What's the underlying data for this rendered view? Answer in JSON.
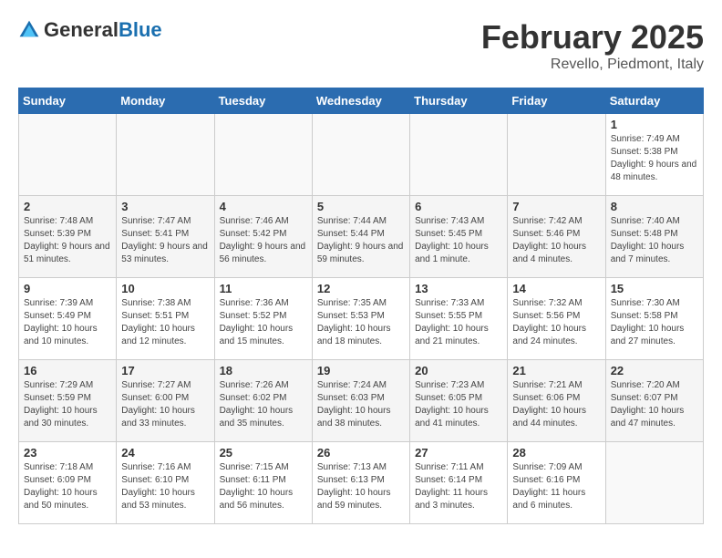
{
  "header": {
    "logo_general": "General",
    "logo_blue": "Blue",
    "title": "February 2025",
    "subtitle": "Revello, Piedmont, Italy"
  },
  "calendar": {
    "days_of_week": [
      "Sunday",
      "Monday",
      "Tuesday",
      "Wednesday",
      "Thursday",
      "Friday",
      "Saturday"
    ],
    "weeks": [
      [
        {
          "day": "",
          "info": ""
        },
        {
          "day": "",
          "info": ""
        },
        {
          "day": "",
          "info": ""
        },
        {
          "day": "",
          "info": ""
        },
        {
          "day": "",
          "info": ""
        },
        {
          "day": "",
          "info": ""
        },
        {
          "day": "1",
          "info": "Sunrise: 7:49 AM\nSunset: 5:38 PM\nDaylight: 9 hours and 48 minutes."
        }
      ],
      [
        {
          "day": "2",
          "info": "Sunrise: 7:48 AM\nSunset: 5:39 PM\nDaylight: 9 hours and 51 minutes."
        },
        {
          "day": "3",
          "info": "Sunrise: 7:47 AM\nSunset: 5:41 PM\nDaylight: 9 hours and 53 minutes."
        },
        {
          "day": "4",
          "info": "Sunrise: 7:46 AM\nSunset: 5:42 PM\nDaylight: 9 hours and 56 minutes."
        },
        {
          "day": "5",
          "info": "Sunrise: 7:44 AM\nSunset: 5:44 PM\nDaylight: 9 hours and 59 minutes."
        },
        {
          "day": "6",
          "info": "Sunrise: 7:43 AM\nSunset: 5:45 PM\nDaylight: 10 hours and 1 minute."
        },
        {
          "day": "7",
          "info": "Sunrise: 7:42 AM\nSunset: 5:46 PM\nDaylight: 10 hours and 4 minutes."
        },
        {
          "day": "8",
          "info": "Sunrise: 7:40 AM\nSunset: 5:48 PM\nDaylight: 10 hours and 7 minutes."
        }
      ],
      [
        {
          "day": "9",
          "info": "Sunrise: 7:39 AM\nSunset: 5:49 PM\nDaylight: 10 hours and 10 minutes."
        },
        {
          "day": "10",
          "info": "Sunrise: 7:38 AM\nSunset: 5:51 PM\nDaylight: 10 hours and 12 minutes."
        },
        {
          "day": "11",
          "info": "Sunrise: 7:36 AM\nSunset: 5:52 PM\nDaylight: 10 hours and 15 minutes."
        },
        {
          "day": "12",
          "info": "Sunrise: 7:35 AM\nSunset: 5:53 PM\nDaylight: 10 hours and 18 minutes."
        },
        {
          "day": "13",
          "info": "Sunrise: 7:33 AM\nSunset: 5:55 PM\nDaylight: 10 hours and 21 minutes."
        },
        {
          "day": "14",
          "info": "Sunrise: 7:32 AM\nSunset: 5:56 PM\nDaylight: 10 hours and 24 minutes."
        },
        {
          "day": "15",
          "info": "Sunrise: 7:30 AM\nSunset: 5:58 PM\nDaylight: 10 hours and 27 minutes."
        }
      ],
      [
        {
          "day": "16",
          "info": "Sunrise: 7:29 AM\nSunset: 5:59 PM\nDaylight: 10 hours and 30 minutes."
        },
        {
          "day": "17",
          "info": "Sunrise: 7:27 AM\nSunset: 6:00 PM\nDaylight: 10 hours and 33 minutes."
        },
        {
          "day": "18",
          "info": "Sunrise: 7:26 AM\nSunset: 6:02 PM\nDaylight: 10 hours and 35 minutes."
        },
        {
          "day": "19",
          "info": "Sunrise: 7:24 AM\nSunset: 6:03 PM\nDaylight: 10 hours and 38 minutes."
        },
        {
          "day": "20",
          "info": "Sunrise: 7:23 AM\nSunset: 6:05 PM\nDaylight: 10 hours and 41 minutes."
        },
        {
          "day": "21",
          "info": "Sunrise: 7:21 AM\nSunset: 6:06 PM\nDaylight: 10 hours and 44 minutes."
        },
        {
          "day": "22",
          "info": "Sunrise: 7:20 AM\nSunset: 6:07 PM\nDaylight: 10 hours and 47 minutes."
        }
      ],
      [
        {
          "day": "23",
          "info": "Sunrise: 7:18 AM\nSunset: 6:09 PM\nDaylight: 10 hours and 50 minutes."
        },
        {
          "day": "24",
          "info": "Sunrise: 7:16 AM\nSunset: 6:10 PM\nDaylight: 10 hours and 53 minutes."
        },
        {
          "day": "25",
          "info": "Sunrise: 7:15 AM\nSunset: 6:11 PM\nDaylight: 10 hours and 56 minutes."
        },
        {
          "day": "26",
          "info": "Sunrise: 7:13 AM\nSunset: 6:13 PM\nDaylight: 10 hours and 59 minutes."
        },
        {
          "day": "27",
          "info": "Sunrise: 7:11 AM\nSunset: 6:14 PM\nDaylight: 11 hours and 3 minutes."
        },
        {
          "day": "28",
          "info": "Sunrise: 7:09 AM\nSunset: 6:16 PM\nDaylight: 11 hours and 6 minutes."
        },
        {
          "day": "",
          "info": ""
        }
      ]
    ]
  }
}
